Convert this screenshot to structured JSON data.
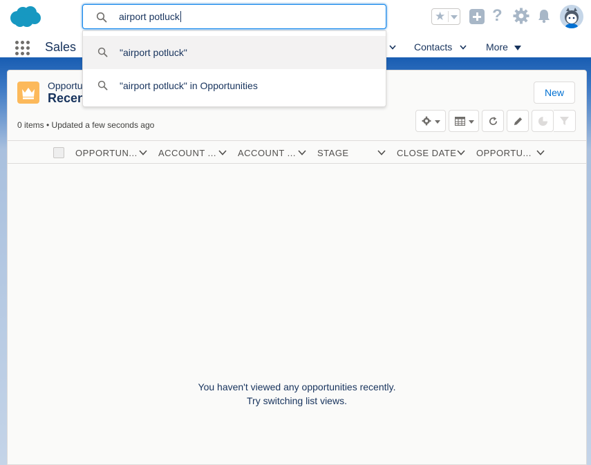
{
  "search": {
    "value": "airport potluck",
    "suggestions": [
      {
        "label": "\"airport potluck\""
      },
      {
        "label": "\"airport potluck\" in Opportunities"
      }
    ]
  },
  "app": {
    "name": "Sales"
  },
  "nav": {
    "items": [
      {
        "label": "Contacts"
      },
      {
        "label": "More"
      }
    ]
  },
  "list": {
    "object_label": "Opportunities",
    "view_name": "Recently Viewed",
    "new_button": "New",
    "meta": "0 items • Updated a few seconds ago",
    "columns": [
      "OPPORTUN...",
      "ACCOUNT ...",
      "ACCOUNT ...",
      "STAGE",
      "CLOSE DATE",
      "OPPORTU..."
    ],
    "empty_line1": "You haven't viewed any opportunities recently.",
    "empty_line2": "Try switching list views."
  },
  "icons": {
    "logo": "salesforce-cloud-icon",
    "favorites": "star-icon",
    "global_actions": "plus-icon",
    "help": "question-icon",
    "setup": "gear-icon",
    "notifications": "bell-icon",
    "object": "crown-icon"
  },
  "colors": {
    "brand": "#1798c1",
    "accent": "#0070d2",
    "object_icon": "#fcb95b"
  }
}
